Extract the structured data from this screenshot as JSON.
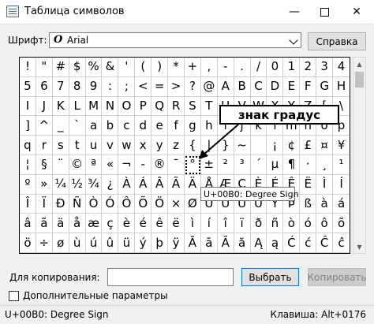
{
  "window": {
    "title": "Таблица символов",
    "controls": {
      "minimize": "—",
      "maximize": "",
      "close": "✕"
    }
  },
  "font_row": {
    "label": "Шрифт:",
    "font_glyph": "O",
    "font_name": "Arial",
    "help_button": "Справка"
  },
  "grid": {
    "rows": [
      [
        "!",
        "\"",
        "#",
        "$",
        "%",
        "&",
        "'",
        "(",
        ")",
        "*",
        "+",
        ",",
        "-",
        ".",
        "/",
        "0",
        "1",
        "2",
        "3",
        "4"
      ],
      [
        "5",
        "6",
        "7",
        "8",
        "9",
        ":",
        ";",
        "<",
        "=",
        ">",
        "?",
        "@",
        "A",
        "B",
        "C",
        "D",
        "E",
        "F",
        "G",
        "H"
      ],
      [
        "I",
        "J",
        "K",
        "L",
        "M",
        "N",
        "O",
        "P",
        "Q",
        "R",
        "S",
        "T",
        "U",
        "V",
        "W",
        "X",
        "Y",
        "Z",
        "[",
        "\\"
      ],
      [
        "]",
        "^",
        "_",
        "`",
        "a",
        "b",
        "c",
        "d",
        "e",
        "f",
        "g",
        "h",
        "i",
        "j",
        "k",
        "l",
        "m",
        "n",
        "o",
        "p"
      ],
      [
        "q",
        "r",
        "s",
        "t",
        "u",
        "v",
        "w",
        "x",
        "y",
        "z",
        "{",
        "|",
        "}",
        "~",
        "",
        "¡",
        "¢",
        "£",
        "¤",
        "¥"
      ],
      [
        "¦",
        "§",
        "¨",
        "©",
        "ª",
        "«",
        "¬",
        "-",
        "®",
        "¯",
        "°",
        "±",
        "²",
        "³",
        "´",
        "µ",
        "¶",
        "·",
        "¸",
        "¹"
      ],
      [
        "º",
        "»",
        "¼",
        "½",
        "¾",
        "¿",
        "À",
        "Á",
        "Â",
        "Ã",
        "Ä",
        "Å",
        "Æ",
        "Ç",
        "È",
        "É",
        "Ê",
        "Ë",
        "Ì",
        "Í"
      ],
      [
        "Î",
        "Ï",
        "Ð",
        "Ñ",
        "Ò",
        "Ó",
        "Ô",
        "Õ",
        "Ö",
        "×",
        "Ø",
        "Ù",
        "Ú",
        "Û",
        "Ü",
        "Ý",
        "Þ",
        "ß",
        "à",
        "á"
      ],
      [
        "â",
        "ã",
        "ä",
        "å",
        "æ",
        "ç",
        "è",
        "é",
        "ê",
        "ë",
        "ì",
        "í",
        "î",
        "ï",
        "ð",
        "ñ",
        "ò",
        "ó",
        "ô",
        "õ"
      ],
      [
        "ö",
        "÷",
        "ø",
        "ù",
        "ú",
        "û",
        "ü",
        "ý",
        "þ",
        "ÿ",
        "Ā",
        "ā",
        "Ă",
        "ă",
        "Ą",
        "ą",
        "Ć",
        "ć",
        "Ĉ",
        "ĉ"
      ]
    ],
    "selected": {
      "row": 5,
      "col": 10
    }
  },
  "annotation": {
    "text": "знак градус"
  },
  "tooltip": {
    "text": "U+00B0: Degree Sign"
  },
  "copy_row": {
    "label": "Для копирования:",
    "value": "",
    "select_button": "Выбрать",
    "copy_button": "Копировать"
  },
  "advanced": {
    "label": "Дополнительные параметры",
    "checked": false
  },
  "statusbar": {
    "left": "U+00B0: Degree Sign",
    "right": "Клавиша: Alt+0176"
  },
  "colors": {
    "accent_border": "#0078d7"
  }
}
